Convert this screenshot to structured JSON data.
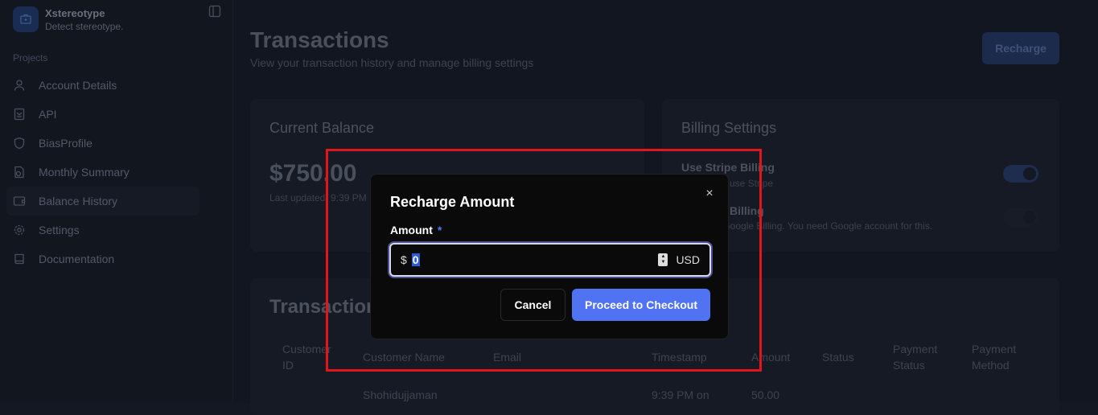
{
  "app": {
    "name": "Xstereotype",
    "tagline": "Detect stereotype."
  },
  "sidebar": {
    "section": "Projects",
    "items": [
      {
        "label": "Account Details",
        "icon": "user-icon"
      },
      {
        "label": "API",
        "icon": "api-icon"
      },
      {
        "label": "BiasProfile",
        "icon": "shield-icon"
      },
      {
        "label": "Monthly Summary",
        "icon": "file-chart-icon"
      },
      {
        "label": "Balance History",
        "icon": "wallet-icon",
        "active": true
      },
      {
        "label": "Settings",
        "icon": "gear-icon"
      },
      {
        "label": "Documentation",
        "icon": "book-icon"
      }
    ]
  },
  "header": {
    "title": "Transactions",
    "subtitle": "View your transaction history and manage billing settings",
    "recharge_label": "Recharge"
  },
  "balance": {
    "title": "Current Balance",
    "amount": "$750.00",
    "updated": "Last updated: 9:39 PM"
  },
  "billing": {
    "title": "Billing Settings",
    "stripe_label": "Use Stripe Billing",
    "stripe_desc": "use Stripe",
    "stripe_on": true,
    "google_label": "Billing",
    "google_desc": "r Google Billing. You need Google account for this.",
    "google_on": false
  },
  "transactions": {
    "title": "Transactions",
    "columns": [
      "Customer ID",
      "Customer Name",
      "Email",
      "Timestamp",
      "Amount",
      "Status",
      "Payment Status",
      "Payment Method"
    ],
    "rows": [
      {
        "id": "",
        "name": "Shohidujjaman",
        "email": "",
        "timestamp": "9:39 PM on",
        "amount": "50.00",
        "status": "",
        "payment_status": "",
        "payment_method": ""
      }
    ]
  },
  "modal": {
    "title": "Recharge Amount",
    "label": "Amount",
    "required": "*",
    "currency_symbol": "$",
    "value": "0",
    "currency": "USD",
    "cancel": "Cancel",
    "proceed": "Proceed to Checkout",
    "close": "×"
  },
  "colors": {
    "accent": "#4f73f3",
    "highlight": "#e0161b"
  }
}
